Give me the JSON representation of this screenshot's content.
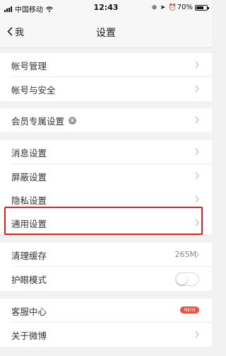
{
  "status_bar": {
    "carrier": "中国移动",
    "time": "12:43",
    "battery": "70%",
    "battery_level": 0.7
  },
  "nav": {
    "back_label": "我",
    "title": "设置"
  },
  "groups": {
    "account": {
      "item_1": "帐号管理",
      "item_2": "帐号与安全"
    },
    "vip": {
      "item_1": "会员专属设置"
    },
    "settings": {
      "item_1": "消息设置",
      "item_2": "屏蔽设置",
      "item_3": "隐私设置",
      "item_4": "通用设置"
    },
    "storage": {
      "item_1": "清理缓存",
      "cache_size": "265M",
      "item_2": "护眼模式"
    },
    "about": {
      "item_1": "客服中心",
      "badge": "NEW",
      "item_2": "关于微博"
    }
  },
  "colors": {
    "highlight_border": "#e31e1e",
    "badge_red": "#f04e3e"
  }
}
